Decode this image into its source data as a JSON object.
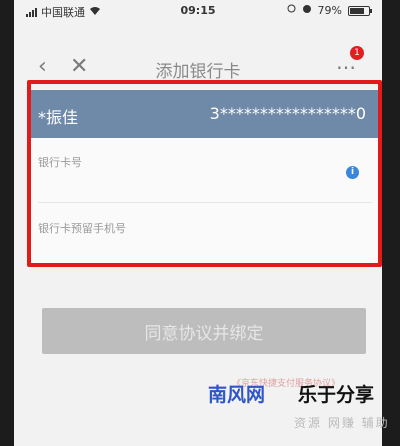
{
  "statusbar": {
    "carrier": "中国联通",
    "time": "09:15",
    "battery": "79%",
    "battery_level": 0.79
  },
  "navbar": {
    "title": "添加银行卡",
    "back_icon": "back-arrow-icon",
    "close_icon": "close-icon",
    "more_icon": "more-icon",
    "badge": "1"
  },
  "card": {
    "holder_name": "*振佳",
    "card_number_masked": "3*****************0"
  },
  "form": {
    "card_number_label": "银行卡号",
    "phone_label": "银行卡预留手机号"
  },
  "colors": {
    "header_row": "#6f8aa8",
    "highlight_border": "#e21a1a",
    "info_icon": "#3a86d8",
    "button_disabled": "#bdbdbd"
  },
  "actions": {
    "agree_bind": "同意协议并绑定",
    "agreement_link": "《京东快捷支付服务协议》"
  },
  "watermark": {
    "brand_blue": "南风网",
    "brand_black": "乐于分享",
    "sub": "资源 网赚 辅助"
  }
}
